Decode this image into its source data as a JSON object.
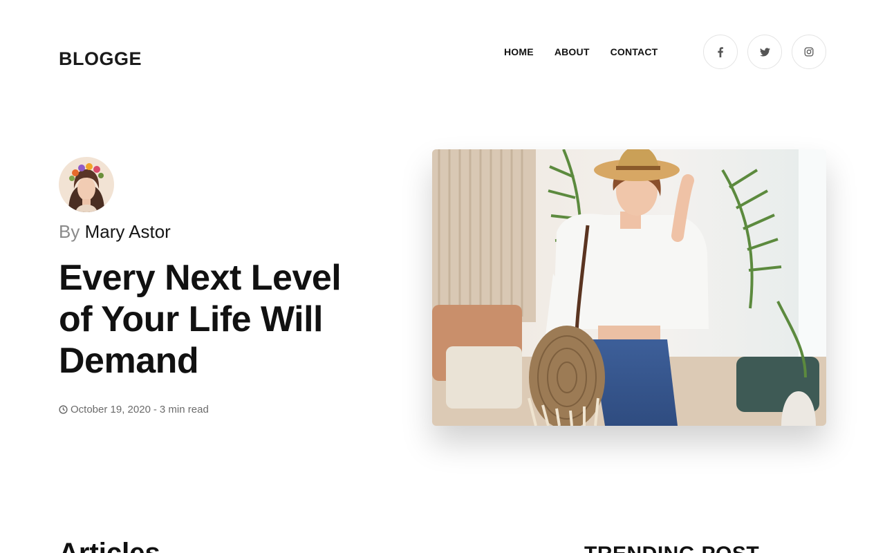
{
  "site": {
    "logo": "BLOGGE"
  },
  "nav": {
    "items": [
      {
        "label": "HOME"
      },
      {
        "label": "ABOUT"
      },
      {
        "label": "CONTACT"
      }
    ]
  },
  "social": {
    "icons": [
      "facebook-icon",
      "twitter-icon",
      "instagram-icon"
    ]
  },
  "post": {
    "by_prefix": "By",
    "author": "Mary Astor",
    "title": "Every Next Level of Your Life Will Demand",
    "date": "October 19, 2020",
    "separator": "-",
    "read_time": "3 min read"
  },
  "sections": {
    "articles_title": "Articles",
    "trending_title": "TRENDING POST"
  },
  "colors": {
    "text": "#141414",
    "muted": "#8a8a8a",
    "border": "#e4e4e4"
  }
}
